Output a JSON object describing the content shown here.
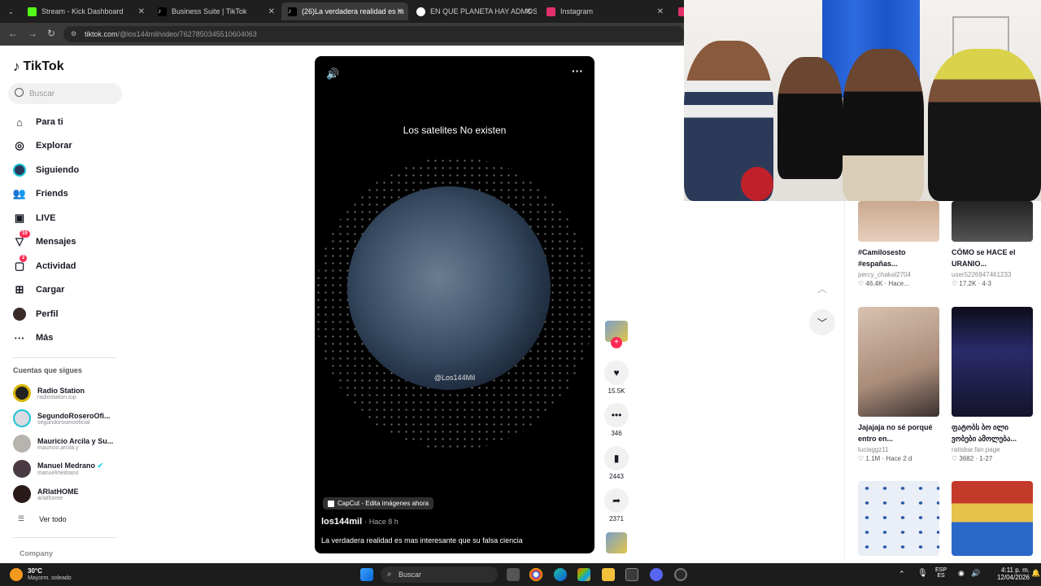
{
  "browser": {
    "tabs": [
      {
        "label": "Stream - Kick Dashboard",
        "color": "#53fc18"
      },
      {
        "label": "Business Suite | TikTok",
        "color": "#000000"
      },
      {
        "label": "(26)La verdadera realidad es m",
        "color": "#000000"
      },
      {
        "label": "EN QUE PLANETA HAY ADMOS",
        "color": "#ffffff"
      },
      {
        "label": "Instagram",
        "color": "#e1306c"
      }
    ],
    "url_domain": "tiktok.com",
    "url_path": "/@los144mil/video/7627850345510604063"
  },
  "sidebar": {
    "logo": "TikTok",
    "search_placeholder": "Buscar",
    "nav": [
      {
        "label": "Para ti",
        "icon": "home-icon"
      },
      {
        "label": "Explorar",
        "icon": "compass-icon"
      },
      {
        "label": "Siguiendo",
        "icon": "following-avatar-icon"
      },
      {
        "label": "Friends",
        "icon": "friends-icon"
      },
      {
        "label": "LIVE",
        "icon": "live-icon"
      },
      {
        "label": "Mensajes",
        "icon": "messages-icon",
        "badge": "19"
      },
      {
        "label": "Actividad",
        "icon": "activity-icon",
        "badge": "2"
      },
      {
        "label": "Cargar",
        "icon": "upload-icon"
      },
      {
        "label": "Perfil",
        "icon": "profile-icon"
      },
      {
        "label": "Más",
        "icon": "more-icon"
      }
    ],
    "following_title": "Cuentas que sigues",
    "accounts": [
      {
        "name": "Radio Station",
        "handle": "radiostation.top"
      },
      {
        "name": "SegundoRoseroOfi...",
        "handle": "segundoroserooficial"
      },
      {
        "name": "Mauricio Arcila y Su...",
        "handle": "mauricio.arcila.y"
      },
      {
        "name": "Manuel Medrano",
        "handle": "manuelmedrano"
      },
      {
        "name": "ARlatHOME",
        "handle": "arlathome"
      }
    ],
    "see_all": "Ver todo",
    "footer": "Company"
  },
  "video": {
    "overlay_text": "Los satelites No existen",
    "watermark": "@Los144Mil",
    "capcut": "CapCut - Edita imágenes ahora",
    "author": "los144mil",
    "time": "· Hace 8 h",
    "description": "La verdadera realidad es mas interesante que su falsa ciencia"
  },
  "actions": {
    "likes": "15.5K",
    "comments": "346",
    "saves": "2443",
    "shares": "2371"
  },
  "related": [
    {
      "title": "#Camilosesto #españas...",
      "user": "percy_chakal2704",
      "meta": "♡ 46.4K · Hace..."
    },
    {
      "title": "CÓMO se HACE el URANIO...",
      "user": "user5226947461233",
      "meta": "♡ 17.2K · 4-3"
    },
    {
      "title": "Jajajaja no sé porqué entro en...",
      "user": "luciaggz11",
      "meta": "♡ 1.1M · Hace 2 d"
    },
    {
      "title": "ფატობს ბო ილი ვობები ამოლება...",
      "user": "ratisbar.fan.page",
      "meta": "♡ 3682 · 1-27"
    }
  ],
  "taskbar": {
    "weather_temp": "30°C",
    "weather_desc": "Mayorm. soleado",
    "search": "Buscar",
    "lang": "ESP",
    "lang2": "ES",
    "time": "4:11 p. m.",
    "date": "12/04/2026"
  }
}
